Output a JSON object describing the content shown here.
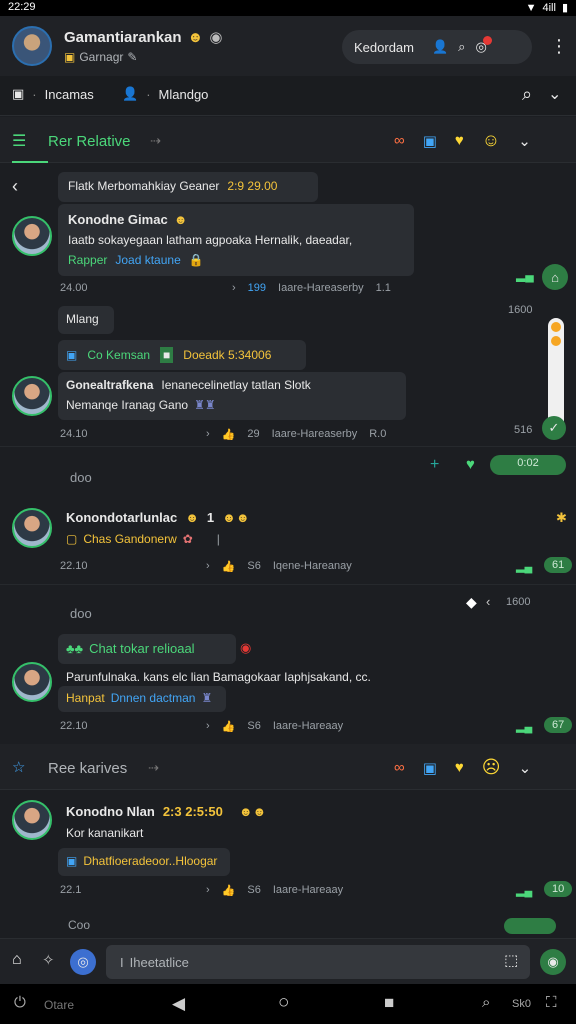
{
  "status": {
    "time": "22:29",
    "signal": "4ill",
    "battery": "▮"
  },
  "header": {
    "title": "Gamantiarankan",
    "subtitle": "Garnagr",
    "pill_label": "Kedordam"
  },
  "tabs": {
    "first": "Incamas",
    "second": "Mlandgo"
  },
  "section1": {
    "label": "Rer Relative"
  },
  "chat": {
    "topline": "Flatk Merbomahkiay Geaner",
    "topline_time": "2:9 29.00",
    "m1": {
      "name": "Konodne Gimac",
      "text": "Iaatb sokayegaan latham  agpoaka Hernalik, daeadar,",
      "link1": "Rapper",
      "link2": "Joad ktaune",
      "time": "24.00",
      "meta1": "199",
      "meta2": "Iaare-Hareaserby",
      "meta3": "1.1"
    },
    "side_time1": "1600",
    "small_bubble": "Mlang",
    "m2": {
      "tag": "Co Kemsan",
      "tag2": "Doeadk 5:34006",
      "name": "Gonealtrafkena",
      "text": "Ienanecelinetlay tatlan Slotk",
      "sub": "Nemanqe Iranag Gano",
      "time": "24.10",
      "meta1": "29",
      "meta2": "Iaare-Hareaserby",
      "meta3": "R.0",
      "side": "516"
    },
    "day1": "doo",
    "pill_time": "0:02",
    "m3": {
      "name": "Konondotarlunlac",
      "num": "1",
      "sub": "Chas Gandonerw",
      "time": "22.10",
      "meta1": "S6",
      "meta2": "Iqene-Hareanay",
      "meta3": "61"
    },
    "day2": "doo",
    "side_time2": "1600",
    "m4": {
      "tag": "Chat tokar relioaal",
      "text": "Parunfulnaka. kans elc lian Bamagokaar Iaphjsakand, cc.",
      "link1": "Hanpat",
      "link2": "Dnnen dactman",
      "time": "22.10",
      "meta1": "S6",
      "meta2": "Iaare-Hareaay",
      "meta3": "67"
    }
  },
  "section2": {
    "label": "Ree karives"
  },
  "m5": {
    "name": "Konodno Nlan",
    "num": "2:3 2:5:50",
    "text": "Kor kananikart",
    "tag": "Dhatfioeradeoor..Hloogar",
    "time": "22.1",
    "meta1": "S6",
    "meta2": "Iaare-Hareaay",
    "meta3": "10",
    "cut": "Coo"
  },
  "input": {
    "placeholder": "Iheetatlice"
  },
  "nav": {
    "left": "Otare",
    "right": "Sk0"
  },
  "colors": {
    "accent": "#4bd77a",
    "bg": "#1c1e22",
    "yellow": "#f3c33b"
  }
}
